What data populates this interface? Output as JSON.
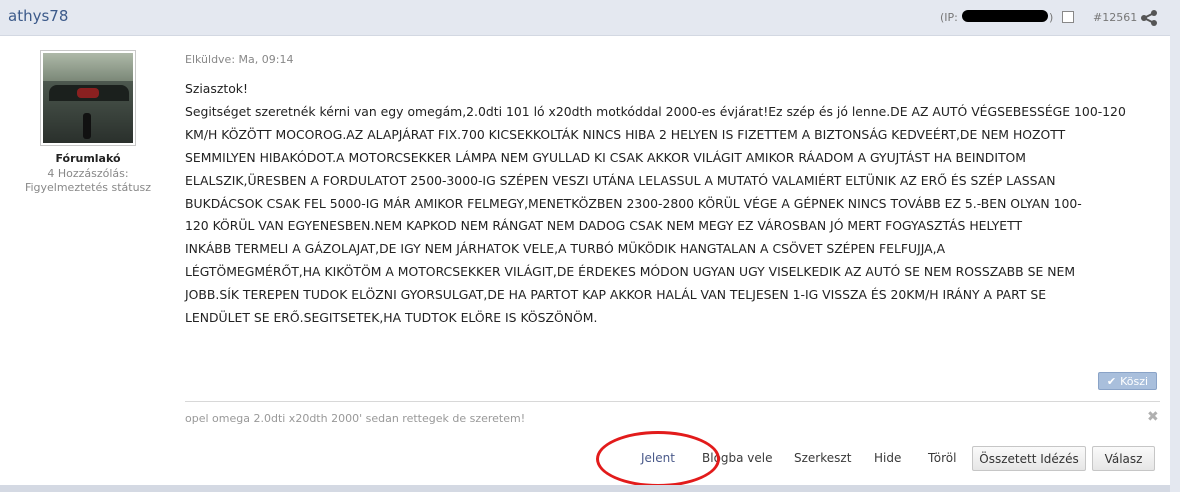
{
  "header": {
    "username": "athys78",
    "ip_label": "(IP:",
    "ip_close": ")",
    "post_number": "#12561",
    "share_icon": "share-icon",
    "checkbox_icon": "checkbox-icon"
  },
  "user_panel": {
    "avatar_icon": "avatar-car-interior",
    "rank": "Fórumlakó",
    "post_count": "4 Hozzászólás:",
    "warning_status": "Figyelmeztetés státusz"
  },
  "post": {
    "sent_at": "Elküldve: Ma, 09:14",
    "greeting": "Sziasztok!",
    "lines": [
      "Segitséget szeretnék kérni van egy omegám,2.0dti 101 ló x20dth motkóddal 2000-es évjárat!Ez szép és jó lenne.DE AZ AUTÓ VÉGSEBESSÉGE 100-120",
      "KM/H KÖZÖTT MOCOROG.AZ ALAPJÁRAT FIX.700 KICSEKKOLTÁK NINCS HIBA 2 HELYEN IS FIZETTEM A BIZTONSÁG KEDVEÉRT,DE NEM HOZOTT",
      "SEMMILYEN HIBAKÓDOT.A MOTORCSEKKER LÁMPA NEM GYULLAD KI CSAK AKKOR VILÁGIT AMIKOR RÁADOM A GYUJTÁST HA BEINDITOM",
      "ELALSZIK,ÜRESBEN A FORDULATOT 2500-3000-IG SZÉPEN VESZI UTÁNA LELASSUL A MUTATÓ VALAMIÉRT ELTÜNIK AZ  ERŐ ÉS SZÉP LASSAN",
      "BUKDÁCSOK CSAK FEL 5000-IG MÁR AMIKOR FELMEGY,MENETKÖZBEN 2300-2800 KÖRÜL VÉGE A GÉPNEK NINCS TOVÁBB EZ 5.-BEN OLYAN 100-",
      "120 KÖRÜL VAN EGYENESBEN.NEM KAPKOD NEM RÁNGAT NEM DADOG CSAK NEM MEGY EZ VÁROSBAN JÓ MERT FOGYASZTÁS HELYETT",
      "INKÁBB TERMELI A GÁZOLAJAT,DE IGY NEM JÁRHATOK VELE,A TURBÓ MÜKÖDIK HANGTALAN A CSÖVET SZÉPEN FELFUJJA,A",
      "LÉGTÖMEGMÉRŐT,HA KIKÖTÖM A MOTORCSEKKER VILÁGIT,DE ÉRDEKES MÓDON UGYAN UGY VISELKEDIK AZ AUTÓ SE NEM ROSSZABB SE NEM",
      "JOBB.SÍK TEREPEN TUDOK ELÖZNI GYORSULGAT,DE HA PARTOT KAP AKKOR HALÁL VAN TELJESEN 1-IG VISSZA ÉS 20KM/H IRÁNY A PART SE",
      "LENDÜLET SE ERŐ.SEGITSETEK,HA TUDTOK ELÖRE IS KÖSZÖNÖM."
    ],
    "thanks_label": "Köszi",
    "signature": "opel omega 2.0dti x20dth 2000' sedan rettegek de szeretem!"
  },
  "actions": {
    "report": "Jelent",
    "blog": "Blogba vele",
    "edit": "Szerkeszt",
    "hide": "Hide",
    "delete": "Töröl",
    "multi_quote": "Összetett Idézés",
    "reply": "Válasz"
  },
  "colors": {
    "header_bg": "#e4e8f0",
    "username": "#3c5a8a",
    "annotation_red": "#e21b1b",
    "thanks_bg": "#a9bfdc"
  }
}
